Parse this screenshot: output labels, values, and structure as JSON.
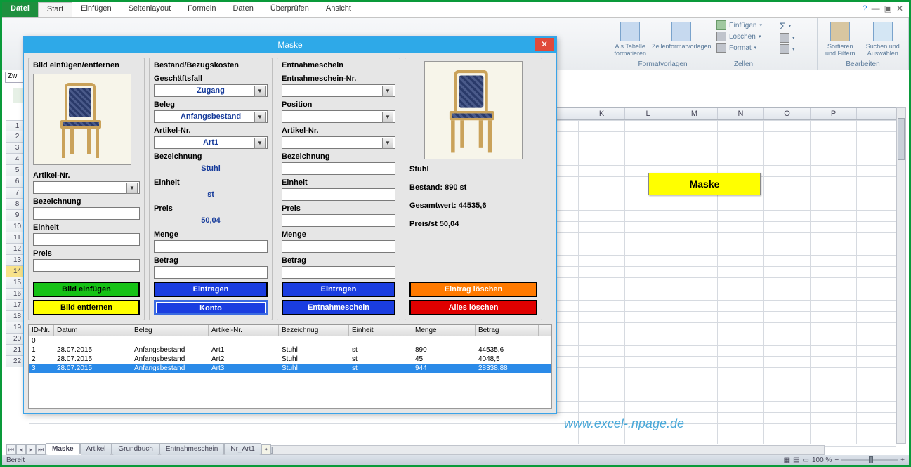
{
  "ribbon": {
    "file": "Datei",
    "tabs": [
      "Start",
      "Einfügen",
      "Seitenlayout",
      "Formeln",
      "Daten",
      "Überprüfen",
      "Ansicht"
    ],
    "active_tab": "Start",
    "groups": {
      "formatvorlagen": {
        "label": "Formatvorlagen",
        "als_tabelle": "Als Tabelle formatieren",
        "zellen_vorl": "Zellenformatvorlagen"
      },
      "zellen": {
        "label": "Zellen",
        "einfuegen": "Einfügen",
        "loeschen": "Löschen",
        "format": "Format"
      },
      "bearbeiten": {
        "label": "Bearbeiten",
        "sortieren": "Sortieren und Filtern",
        "suchen": "Suchen und Auswählen"
      }
    }
  },
  "name_box": "Zw",
  "columns_right": [
    "K",
    "L",
    "M",
    "N",
    "O",
    "P"
  ],
  "rows": [
    1,
    2,
    3,
    4,
    5,
    6,
    7,
    8,
    9,
    10,
    11,
    12,
    13,
    14,
    15,
    16,
    17,
    18,
    19,
    20,
    21,
    22
  ],
  "selected_row": 14,
  "sheet_maske_btn": "Maske",
  "sheet_tabs": [
    "Maske",
    "Artikel",
    "Grundbuch",
    "Entnahmeschein",
    "Nr_Art1"
  ],
  "active_sheet": "Maske",
  "status": {
    "ready": "Bereit",
    "zoom": "100 %",
    "minus": "−",
    "plus": "+"
  },
  "watermark": "www.excel-.npage.de",
  "dialog": {
    "title": "Maske",
    "panel1": {
      "title": "Bild einfügen/entfernen",
      "artikel_nr_label": "Artikel-Nr.",
      "artikel_nr": "",
      "bezeichnung_label": "Bezeichnung",
      "bezeichnung": "",
      "einheit_label": "Einheit",
      "einheit": "",
      "preis_label": "Preis",
      "preis": "",
      "btn_insert": "Bild einfügen",
      "btn_remove": "Bild entfernen"
    },
    "panel2": {
      "title": "Bestand/Bezugskosten",
      "geschaeftsfall_label": "Geschäftsfall",
      "geschaeftsfall": "Zugang",
      "beleg_label": "Beleg",
      "beleg": "Anfangsbestand",
      "artikel_nr_label": "Artikel-Nr.",
      "artikel_nr": "Art1",
      "bezeichnung_label": "Bezeichnung",
      "bezeichnung": "Stuhl",
      "einheit_label": "Einheit",
      "einheit": "st",
      "preis_label": "Preis",
      "preis": "50,04",
      "menge_label": "Menge",
      "menge": "",
      "betrag_label": "Betrag",
      "betrag": "",
      "btn_enter": "Eintragen",
      "btn_konto": "Konto"
    },
    "panel3": {
      "title": "Entnahmeschein",
      "nr_label": "Entnahmeschein-Nr.",
      "nr": "",
      "position_label": "Position",
      "position": "",
      "artikel_nr_label": "Artikel-Nr.",
      "artikel_nr": "",
      "bezeichnung_label": "Bezeichnung",
      "bezeichnung": "",
      "einheit_label": "Einheit",
      "einheit": "",
      "preis_label": "Preis",
      "preis": "",
      "menge_label": "Menge",
      "menge": "",
      "betrag_label": "Betrag",
      "betrag": "",
      "btn_enter": "Eintragen",
      "btn_schein": "Entnahmeschein"
    },
    "panel4": {
      "name": "Stuhl",
      "bestand": "Bestand: 890 st",
      "gesamt": "Gesamtwert: 44535,6",
      "preis": "Preis/st 50,04",
      "btn_del_entry": "Eintrag löschen",
      "btn_del_all": "Alles löschen"
    },
    "table": {
      "headers": [
        "ID-Nr.",
        "Datum",
        "Beleg",
        "Artikel-Nr.",
        "Bezeichnug",
        "Einheit",
        "Menge",
        "Betrag"
      ],
      "rows": [
        {
          "id": "0",
          "datum": "",
          "beleg": "",
          "art": "",
          "bez": "",
          "ein": "",
          "men": "",
          "bet": ""
        },
        {
          "id": "1",
          "datum": "28.07.2015",
          "beleg": "Anfangsbestand",
          "art": "Art1",
          "bez": "Stuhl",
          "ein": "st",
          "men": "890",
          "bet": "44535,6"
        },
        {
          "id": "2",
          "datum": "28.07.2015",
          "beleg": "Anfangsbestand",
          "art": "Art2",
          "bez": "Stuhl",
          "ein": "st",
          "men": "45",
          "bet": "4048,5"
        },
        {
          "id": "3",
          "datum": "28.07.2015",
          "beleg": "Anfangsbestand",
          "art": "Art3",
          "bez": "Stuhl",
          "ein": "st",
          "men": "944",
          "bet": "28338,88"
        }
      ],
      "selected": 3
    }
  }
}
